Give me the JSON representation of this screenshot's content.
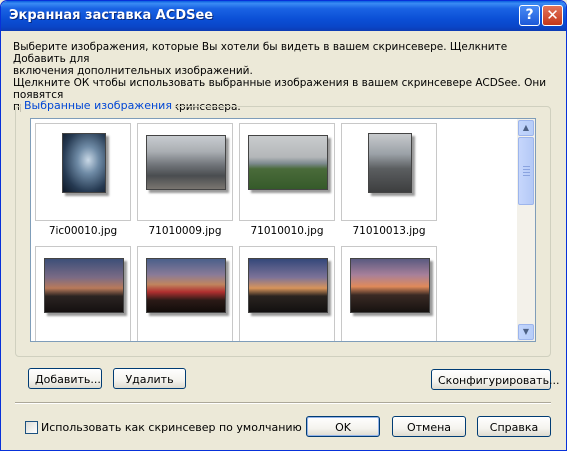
{
  "window": {
    "title": "Экранная заставка ACDSee",
    "help_glyph": "?",
    "close_glyph": "✕"
  },
  "description": {
    "line1": "Выберите изображения, которые Вы хотели бы видеть в вашем скринсевере. Щелкните Добавить для",
    "line2": "включения дополнительных изображений.",
    "line3": "Щелкните ОК чтобы использовать выбранные изображения в вашем скринсевере ACDSee. Они появятся",
    "line4": "при следующей активации скринсевера."
  },
  "selected_images": {
    "label": "Выбранные изображения",
    "row1": [
      {
        "caption": "7ic00010.jpg"
      },
      {
        "caption": "71010009.jpg"
      },
      {
        "caption": "71010010.jpg"
      },
      {
        "caption": "71010013.jpg"
      }
    ],
    "row2": [
      {
        "caption": ""
      },
      {
        "caption": ""
      },
      {
        "caption": ""
      },
      {
        "caption": ""
      }
    ],
    "scroll_up_glyph": "▲",
    "scroll_down_glyph": "▼"
  },
  "buttons": {
    "add": "Добавить...",
    "remove": "Удалить",
    "configure": "Сконфигурировать...",
    "ok": "OK",
    "cancel": "Отмена",
    "help": "Справка"
  },
  "default_checkbox": {
    "label": "Использовать как скринсевер по умолчанию",
    "checked": false
  },
  "colors": {
    "title_bar": "#0a4fd6",
    "group_label": "#0046d5",
    "dialog_bg": "#ece9d8"
  }
}
